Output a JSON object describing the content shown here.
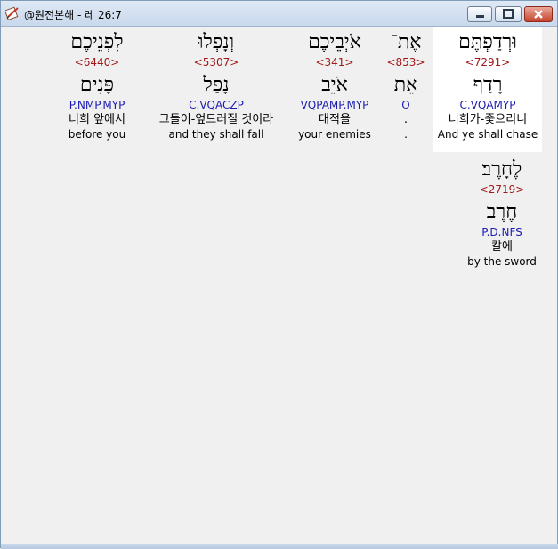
{
  "window": {
    "title": "@원전본해 - 레 26:7",
    "icon": "book-edit-icon",
    "buttons": {
      "minimize": "minimize-icon",
      "maximize": "maximize-icon",
      "close": "close-icon"
    }
  },
  "words": [
    {
      "hebrew": "וּרְדַפְתֶּם",
      "strong": "<7291>",
      "lemma": "רָדַף",
      "parse": "C.VQAMYP",
      "korean": "너희가-좇으리니",
      "english": "And ye shall chase",
      "selected": true
    },
    {
      "hebrew": "אֶת־",
      "strong": "<853>",
      "lemma": "אֵת",
      "parse": "O",
      "korean": ".",
      "english": ".",
      "selected": false
    },
    {
      "hebrew": "אֹיְבֵיכֶם",
      "strong": "<341>",
      "lemma": "אֹיֵב",
      "parse": "VQPAMP.MYP",
      "korean": "대적을",
      "english": "your enemies",
      "selected": false
    },
    {
      "hebrew": "וְנָפְלוּ",
      "strong": "<5307>",
      "lemma": "נָפַל",
      "parse": "C.VQACZP",
      "korean": "그들이-엎드러질 것이라",
      "english": "and they shall fall",
      "selected": false
    },
    {
      "hebrew": "לִפְנֵיכֶם",
      "strong": "<6440>",
      "lemma": "פָּנִים",
      "parse": "P.NMP.MYP",
      "korean": "너희 앞에서",
      "english": "before you",
      "selected": false
    },
    {
      "hebrew": "לֶחָרֶב׃",
      "strong": "<2719>",
      "lemma": "חֶרֶב",
      "parse": "P.D.NFS",
      "korean": "칼에",
      "english": "by the sword",
      "selected": false
    }
  ]
}
